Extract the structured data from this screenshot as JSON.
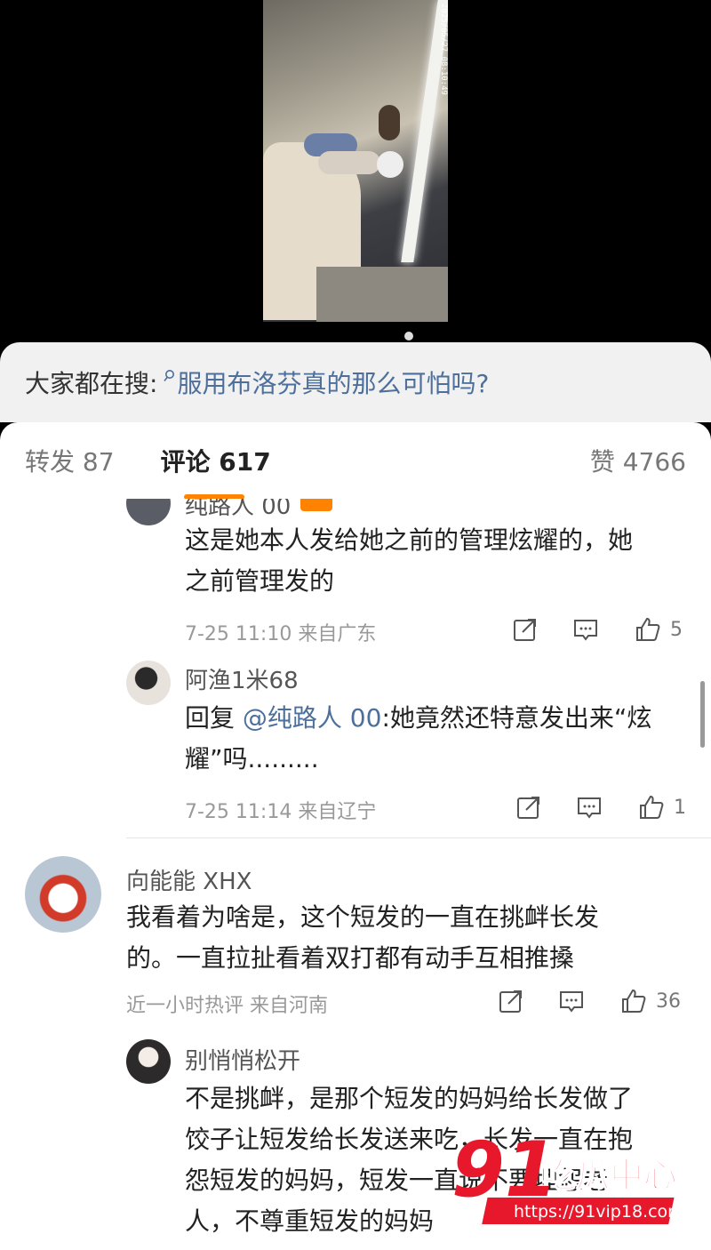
{
  "video": {
    "timestamp": "2025/05/27 08:10:49"
  },
  "search_suggest": {
    "prefix": "大家都在搜:",
    "query": "服用布洛芬真的那么可怕吗?"
  },
  "tabs": {
    "repost": "转发 87",
    "comments": "评论 617",
    "likes": "赞 4766"
  },
  "comments": [
    {
      "name": "纯路人 00",
      "text": "这是她本人发给她之前的管理炫耀的，她之前管理发的",
      "line1": "这是她本人发给她之前的管理炫耀的，她",
      "line2": "之前管理发的",
      "meta": "7-25 11:10  来自广东",
      "likes": "5"
    },
    {
      "name": "阿渔1米68",
      "reply_prefix": "回复 ",
      "mention": "@纯路人 00",
      "line1_rest": ":她竟然还特意发出来“炫",
      "line2": "耀”吗.........",
      "meta": "7-25 11:14  来自辽宁",
      "likes": "1"
    },
    {
      "name": "向能能 XHX",
      "line1": "我看着为啥是，这个短发的一直在挑衅长发",
      "line2": "的。一直拉扯看着双打都有动手互相推搡",
      "meta": "近一小时热评  来自河南",
      "likes": "36"
    },
    {
      "name": "别悄悄松开",
      "line1": "不是挑衅，是那个短发的妈妈给长发做了",
      "line2": "饺子让短发给长发送来吃，长发一直在抱",
      "line3": "怨短发的妈妈，短发一直说不要埋怨老",
      "line4": "人，不尊重短发的妈妈"
    }
  ],
  "watermark": {
    "number": "91",
    "title": "吃瓜中心",
    "url": "https://91vip18.com"
  },
  "colors": {
    "accent": "#ff8200",
    "link": "#4d6f9c",
    "watermark_red": "#e8182c"
  }
}
